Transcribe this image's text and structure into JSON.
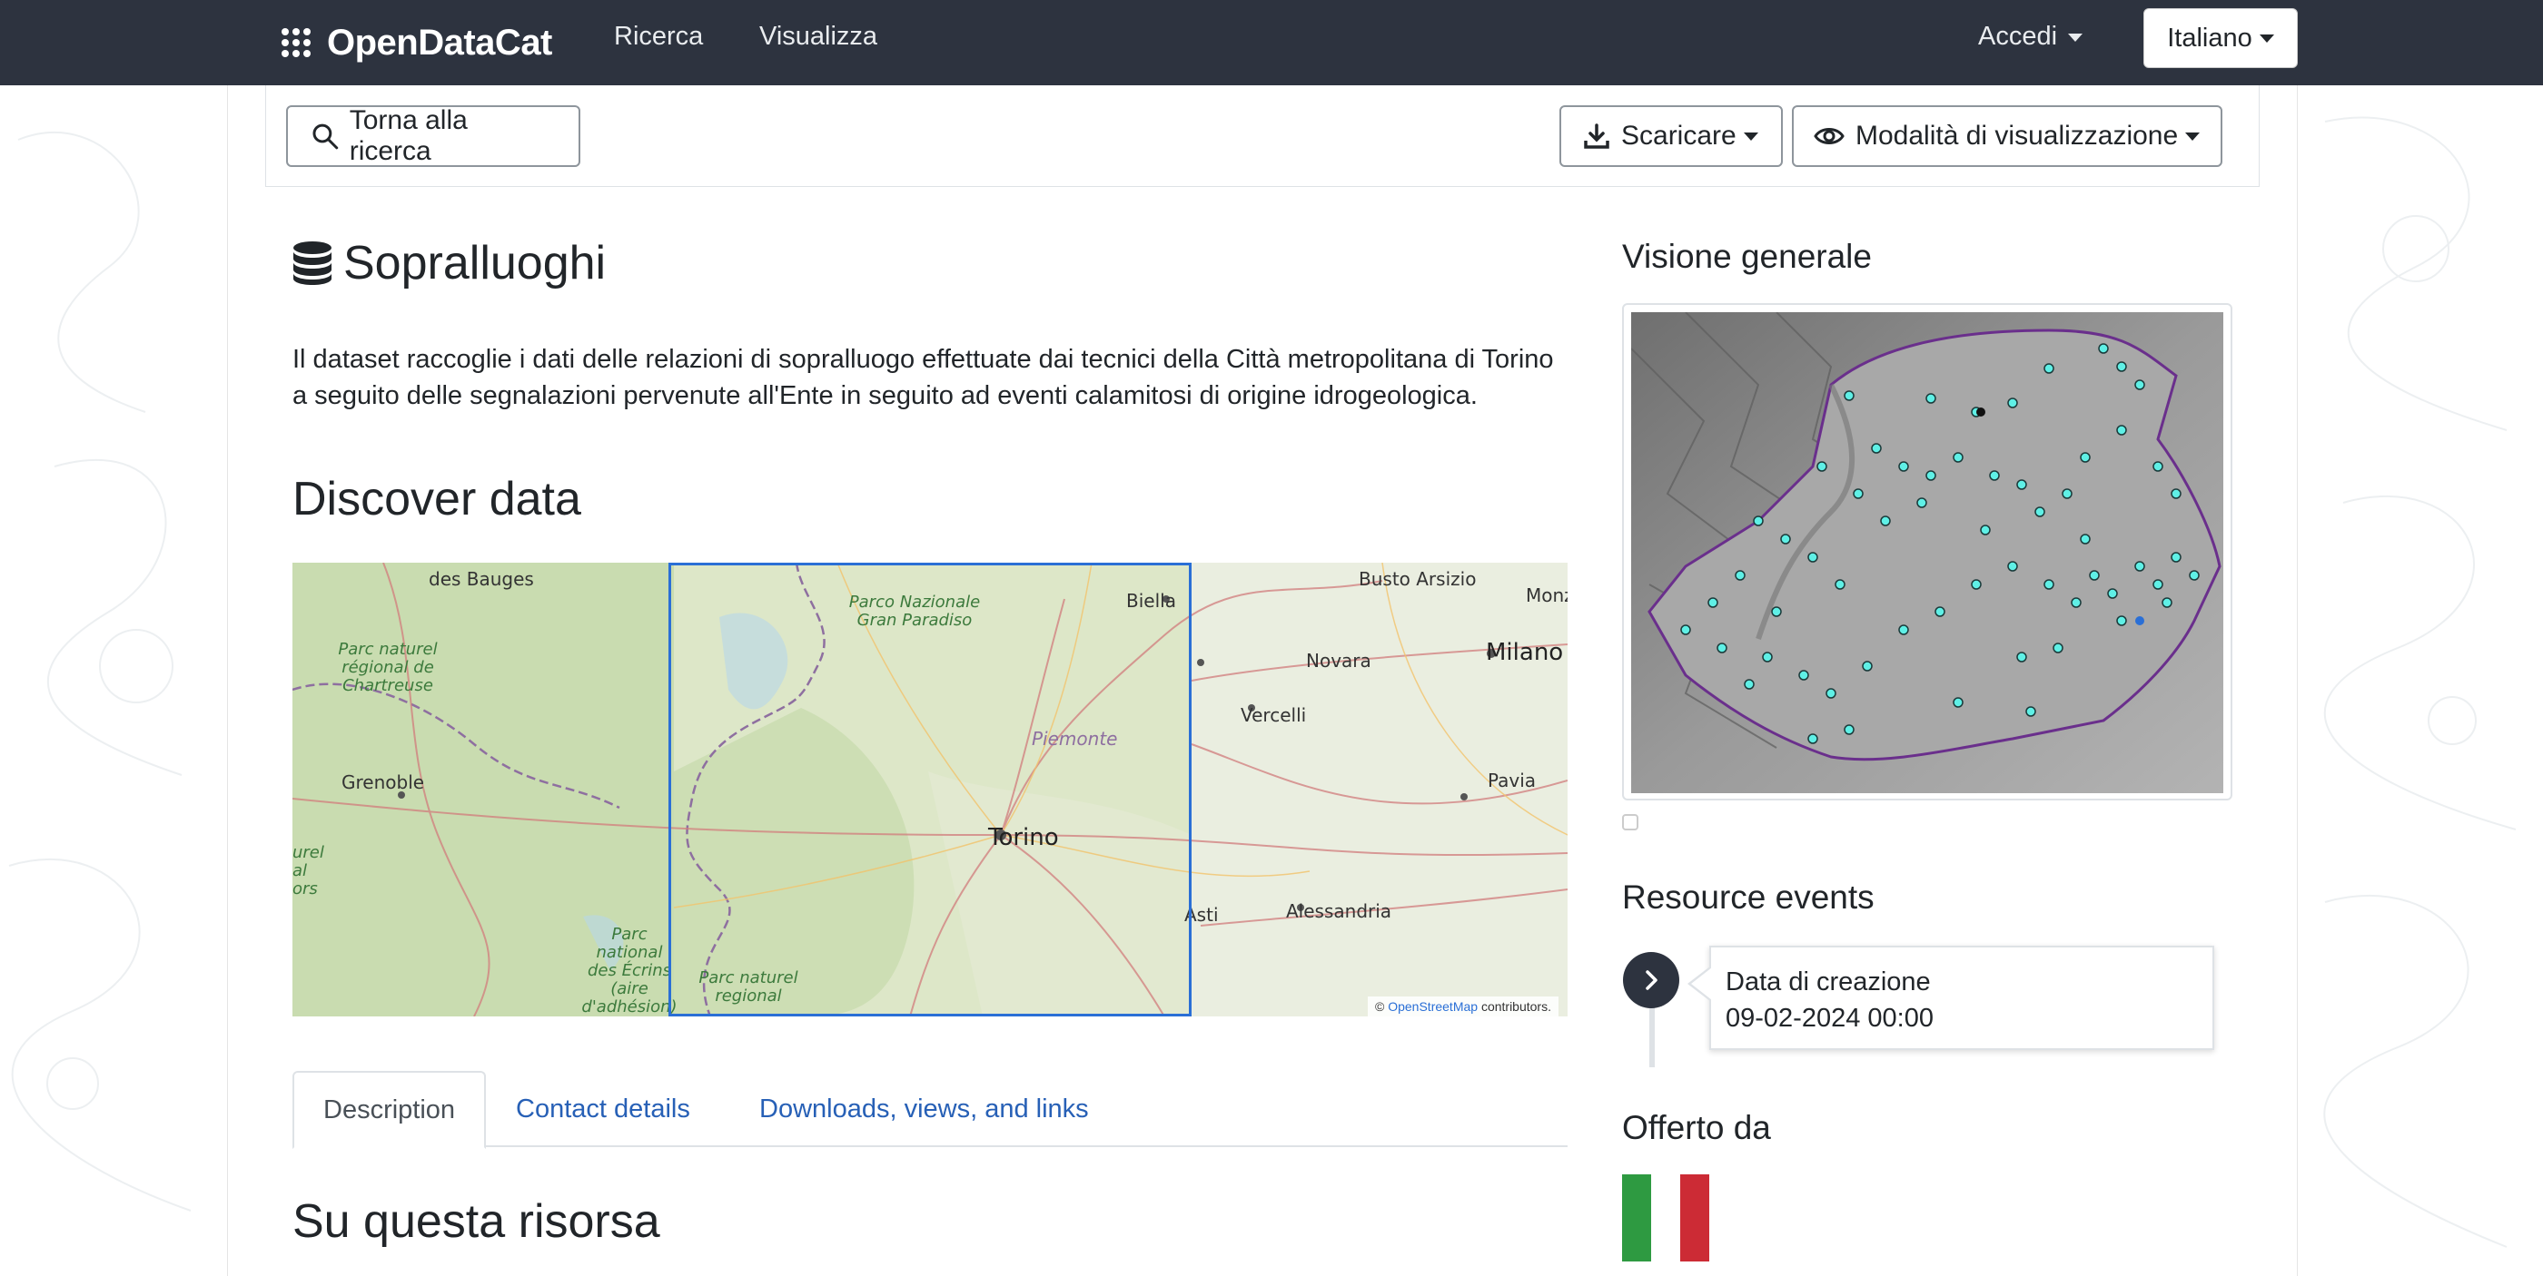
{
  "navbar": {
    "brand": "OpenDataCat",
    "links": [
      "Ricerca",
      "Visualizza"
    ],
    "login": "Accedi",
    "language": "Italiano"
  },
  "toolbar": {
    "back_label": "Torna alla ricerca",
    "download_label": "Scaricare",
    "view_mode_label": "Modalità di visualizzazione"
  },
  "dataset": {
    "title": "Sopralluoghi",
    "description": "Il dataset raccoglie i dati delle relazioni di sopralluogo effettuate dai tecnici della Città metropolitana di Torino a seguito delle segnalazioni pervenute all'Ente in seguito ad eventi calamitosi di origine idrogeologica."
  },
  "discover": {
    "heading": "Discover data",
    "map_labels": {
      "bauges": "des Bauges",
      "chartreuse": "Parc naturel régional de Chartreuse",
      "grenoble": "Grenoble",
      "gran_paradiso": "Parco Nazionale Gran Paradiso",
      "biella": "Biella",
      "busto": "Busto Arsizio",
      "monza": "Monz",
      "novara": "Novara",
      "milano": "Milano",
      "vercelli": "Vercelli",
      "piemonte": "Piemonte",
      "torino": "Torino",
      "pavia": "Pavia",
      "asti": "Asti",
      "alessandria": "Alessandria",
      "ecrins": "Parc national des Écrins (aire d'adhésion)",
      "regional": "Parc naturel regional",
      "left_edge": "urel al ors"
    },
    "attribution_prefix": "© ",
    "attribution_link": "OpenStreetMap",
    "attribution_suffix": " contributors."
  },
  "tabs": [
    {
      "label": "Description",
      "active": true
    },
    {
      "label": "Contact details",
      "active": false
    },
    {
      "label": "Downloads, views, and links",
      "active": false
    }
  ],
  "about": {
    "heading": "Su questa risorsa"
  },
  "sidebar": {
    "overview_heading": "Visione generale",
    "events_heading": "Resource events",
    "event": {
      "label": "Data di creazione",
      "date": "09-02-2024 00:00"
    },
    "offered_heading": "Offerto da"
  },
  "colors": {
    "navbar": "#2d333f",
    "link": "#2760b6",
    "selection": "#2a6fd6",
    "flag_green": "#2e9a41",
    "flag_white": "#ffffff",
    "flag_red": "#cc2b35"
  }
}
